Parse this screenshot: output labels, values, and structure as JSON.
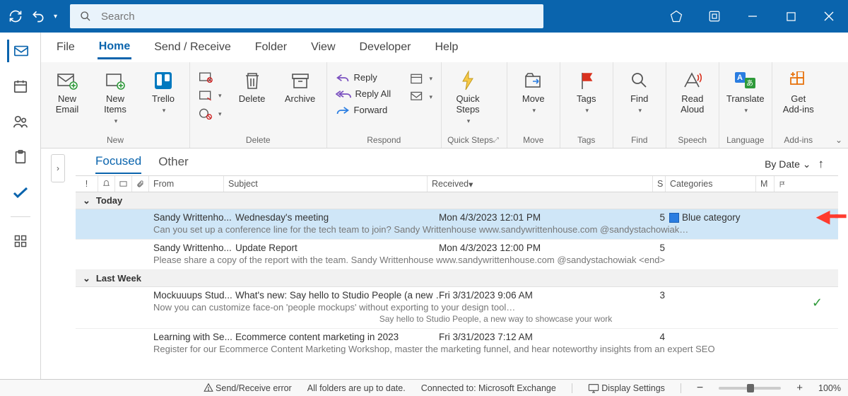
{
  "search": {
    "placeholder": "Search"
  },
  "menu": {
    "items": [
      "File",
      "Home",
      "Send / Receive",
      "Folder",
      "View",
      "Developer",
      "Help"
    ],
    "active": "Home"
  },
  "ribbon": {
    "new": {
      "label": "New",
      "email": "New\nEmail",
      "items": "New\nItems",
      "trello": "Trello"
    },
    "delete": {
      "label": "Delete",
      "delete": "Delete",
      "archive": "Archive"
    },
    "respond": {
      "label": "Respond",
      "reply": "Reply",
      "reply_all": "Reply All",
      "forward": "Forward"
    },
    "quicksteps": {
      "label": "Quick Steps",
      "main": "Quick\nSteps"
    },
    "move": {
      "label": "Move",
      "move": "Move"
    },
    "tags": {
      "label": "Tags",
      "tags": "Tags"
    },
    "find": {
      "label": "Find",
      "find": "Find"
    },
    "speech": {
      "label": "Speech",
      "read": "Read\nAloud"
    },
    "language": {
      "label": "Language",
      "translate": "Translate"
    },
    "addins": {
      "label": "Add-ins",
      "get": "Get\nAdd-ins"
    }
  },
  "msglist": {
    "tabs": {
      "focused": "Focused",
      "other": "Other"
    },
    "sort": "By Date",
    "columns": {
      "from": "From",
      "subject": "Subject",
      "received": "Received",
      "size": "S",
      "categories": "Categories",
      "mention": "M"
    },
    "sections": {
      "today": "Today",
      "lastweek": "Last Week"
    },
    "rows": [
      {
        "from": "Sandy Writtenho...",
        "subject": "Wednesday's meeting",
        "received": "Mon 4/3/2023 12:01 PM",
        "size": "5",
        "categories": "Blue category",
        "preview": "Can you set up a conference line for the tech team to join?   Sandy Writtenhouse   www.sandywrittenhouse.com   @sandystachowiak…"
      },
      {
        "from": "Sandy Writtenho...",
        "subject": "Update Report",
        "received": "Mon 4/3/2023 12:00 PM",
        "size": "5",
        "categories": "",
        "preview": "Please share a copy of the report with the team.   Sandy Writtenhouse   www.sandywrittenhouse.com   @sandystachowiak <end>"
      },
      {
        "from": "Mockuuups Stud...",
        "subject": "What's new: Say hello to Studio People (a new …",
        "received": "Fri 3/31/2023 9:06 AM",
        "size": "3",
        "categories": "",
        "preview": "Now you can customize face-on 'people mockups' without exporting to your design tool…",
        "mention": "Say hello to Studio People, a new way to showcase your work"
      },
      {
        "from": "Learning with Se...",
        "subject": "Ecommerce content marketing in 2023",
        "received": "Fri 3/31/2023 7:12 AM",
        "size": "4",
        "categories": "",
        "preview": "Register for our Ecommerce Content Marketing Workshop, master the marketing funnel, and hear noteworthy insights from an expert SEO"
      }
    ]
  },
  "status": {
    "error": "Send/Receive error",
    "uptodate": "All folders are up to date.",
    "connected": "Connected to: Microsoft Exchange",
    "display": "Display Settings",
    "zoom": "100%"
  }
}
